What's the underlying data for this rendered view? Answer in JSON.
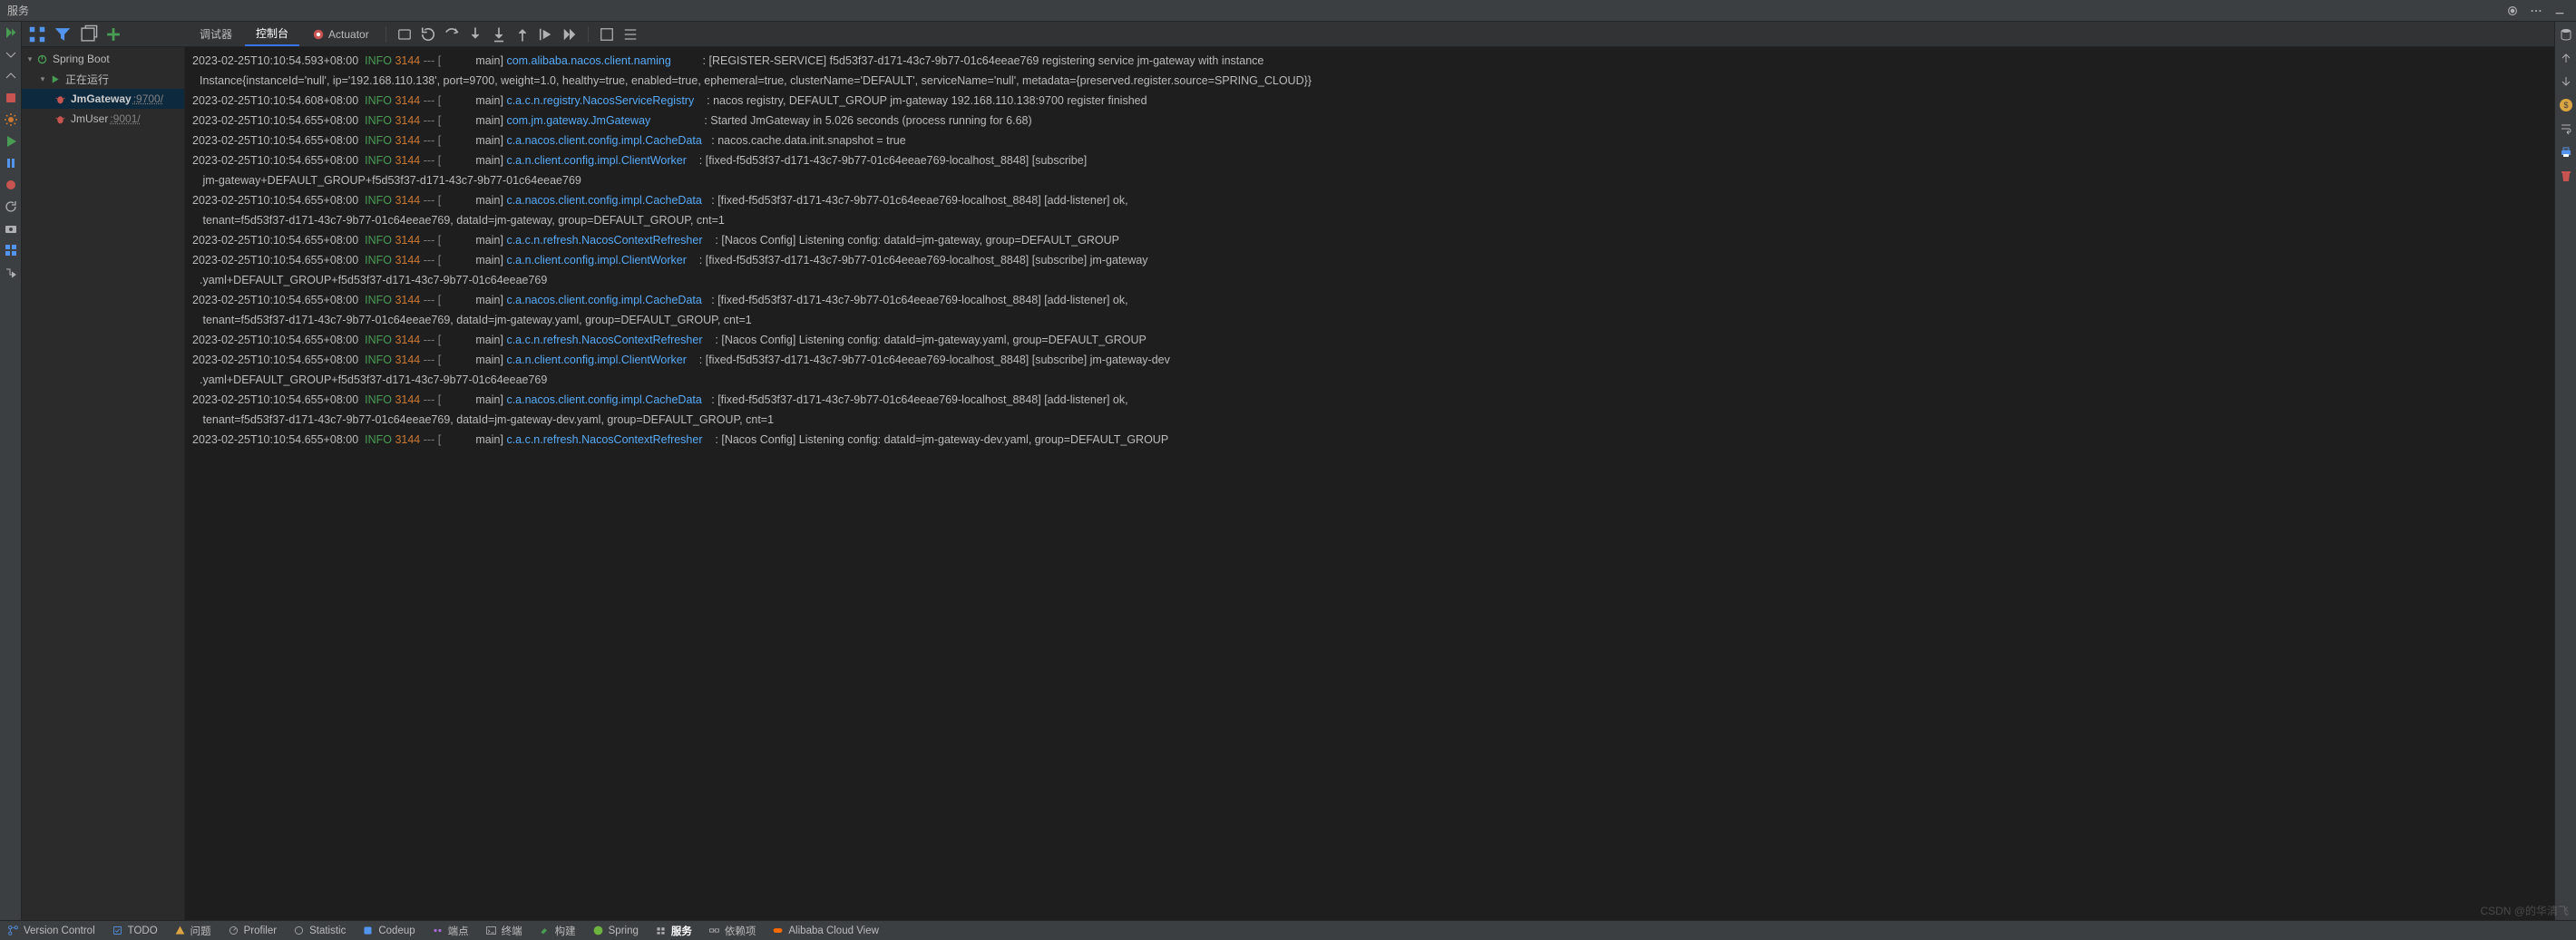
{
  "header": {
    "title": "服务"
  },
  "tree": {
    "root": {
      "label": "Spring Boot"
    },
    "running": {
      "label": "正在运行"
    },
    "apps": [
      {
        "name": "JmGateway",
        "port": ":9700/",
        "selected": true
      },
      {
        "name": "JmUser",
        "port": ":9001/",
        "selected": false
      }
    ]
  },
  "console_tabs": {
    "debugger": "调试器",
    "console": "控制台",
    "actuator": "Actuator"
  },
  "bottom": {
    "version_control": "Version Control",
    "todo": "TODO",
    "problems": "问题",
    "profiler": "Profiler",
    "statistic": "Statistic",
    "codeup": "Codeup",
    "endpoints": "端点",
    "terminal": "终端",
    "build": "构建",
    "spring": "Spring",
    "services": "服务",
    "dependencies": "依赖项",
    "alibaba": "Alibaba Cloud View"
  },
  "watermark": "CSDN @的华清飞",
  "log_lines": [
    {
      "ts": "2023-02-25T10:10:54.593+08:00",
      "level": "INFO",
      "pid": "3144",
      "thread": "main",
      "logger": "com.alibaba.nacos.client.naming",
      "msg": ": [REGISTER-SERVICE] f5d53f37-d171-43c7-9b77-01c64eeae769 registering service jm-gateway with instance"
    },
    {
      "cont": "Instance{instanceId='null', ip='192.168.110.138', port=9700, weight=1.0, healthy=true, enabled=true, ephemeral=true, clusterName='DEFAULT', serviceName='null', metadata={preserved.register.source=SPRING_CLOUD}}"
    },
    {
      "ts": "2023-02-25T10:10:54.608+08:00",
      "level": "INFO",
      "pid": "3144",
      "thread": "main",
      "logger": "c.a.c.n.registry.NacosServiceRegistry",
      "msg": ": nacos registry, DEFAULT_GROUP jm-gateway 192.168.110.138:9700 register finished"
    },
    {
      "ts": "2023-02-25T10:10:54.655+08:00",
      "level": "INFO",
      "pid": "3144",
      "thread": "main",
      "logger": "com.jm.gateway.JmGateway",
      "msg": ": Started JmGateway in 5.026 seconds (process running for 6.68)"
    },
    {
      "ts": "2023-02-25T10:10:54.655+08:00",
      "level": "INFO",
      "pid": "3144",
      "thread": "main",
      "logger": "c.a.nacos.client.config.impl.CacheData",
      "msg": ": nacos.cache.data.init.snapshot = true"
    },
    {
      "ts": "2023-02-25T10:10:54.655+08:00",
      "level": "INFO",
      "pid": "3144",
      "thread": "main",
      "logger": "c.a.n.client.config.impl.ClientWorker",
      "msg": ": [fixed-f5d53f37-d171-43c7-9b77-01c64eeae769-localhost_8848] [subscribe]"
    },
    {
      "cont": " jm-gateway+DEFAULT_GROUP+f5d53f37-d171-43c7-9b77-01c64eeae769"
    },
    {
      "ts": "2023-02-25T10:10:54.655+08:00",
      "level": "INFO",
      "pid": "3144",
      "thread": "main",
      "logger": "c.a.nacos.client.config.impl.CacheData",
      "msg": ": [fixed-f5d53f37-d171-43c7-9b77-01c64eeae769-localhost_8848] [add-listener] ok,"
    },
    {
      "cont": " tenant=f5d53f37-d171-43c7-9b77-01c64eeae769, dataId=jm-gateway, group=DEFAULT_GROUP, cnt=1"
    },
    {
      "ts": "2023-02-25T10:10:54.655+08:00",
      "level": "INFO",
      "pid": "3144",
      "thread": "main",
      "logger": "c.a.c.n.refresh.NacosContextRefresher",
      "msg": ": [Nacos Config] Listening config: dataId=jm-gateway, group=DEFAULT_GROUP"
    },
    {
      "ts": "2023-02-25T10:10:54.655+08:00",
      "level": "INFO",
      "pid": "3144",
      "thread": "main",
      "logger": "c.a.n.client.config.impl.ClientWorker",
      "msg": ": [fixed-f5d53f37-d171-43c7-9b77-01c64eeae769-localhost_8848] [subscribe] jm-gateway"
    },
    {
      "cont": ".yaml+DEFAULT_GROUP+f5d53f37-d171-43c7-9b77-01c64eeae769"
    },
    {
      "ts": "2023-02-25T10:10:54.655+08:00",
      "level": "INFO",
      "pid": "3144",
      "thread": "main",
      "logger": "c.a.nacos.client.config.impl.CacheData",
      "msg": ": [fixed-f5d53f37-d171-43c7-9b77-01c64eeae769-localhost_8848] [add-listener] ok,"
    },
    {
      "cont": " tenant=f5d53f37-d171-43c7-9b77-01c64eeae769, dataId=jm-gateway.yaml, group=DEFAULT_GROUP, cnt=1"
    },
    {
      "ts": "2023-02-25T10:10:54.655+08:00",
      "level": "INFO",
      "pid": "3144",
      "thread": "main",
      "logger": "c.a.c.n.refresh.NacosContextRefresher",
      "msg": ": [Nacos Config] Listening config: dataId=jm-gateway.yaml, group=DEFAULT_GROUP"
    },
    {
      "ts": "2023-02-25T10:10:54.655+08:00",
      "level": "INFO",
      "pid": "3144",
      "thread": "main",
      "logger": "c.a.n.client.config.impl.ClientWorker",
      "msg": ": [fixed-f5d53f37-d171-43c7-9b77-01c64eeae769-localhost_8848] [subscribe] jm-gateway-dev"
    },
    {
      "cont": ".yaml+DEFAULT_GROUP+f5d53f37-d171-43c7-9b77-01c64eeae769"
    },
    {
      "ts": "2023-02-25T10:10:54.655+08:00",
      "level": "INFO",
      "pid": "3144",
      "thread": "main",
      "logger": "c.a.nacos.client.config.impl.CacheData",
      "msg": ": [fixed-f5d53f37-d171-43c7-9b77-01c64eeae769-localhost_8848] [add-listener] ok,"
    },
    {
      "cont": " tenant=f5d53f37-d171-43c7-9b77-01c64eeae769, dataId=jm-gateway-dev.yaml, group=DEFAULT_GROUP, cnt=1"
    },
    {
      "ts": "2023-02-25T10:10:54.655+08:00",
      "level": "INFO",
      "pid": "3144",
      "thread": "main",
      "logger": "c.a.c.n.refresh.NacosContextRefresher",
      "msg": ": [Nacos Config] Listening config: dataId=jm-gateway-dev.yaml, group=DEFAULT_GROUP"
    }
  ]
}
